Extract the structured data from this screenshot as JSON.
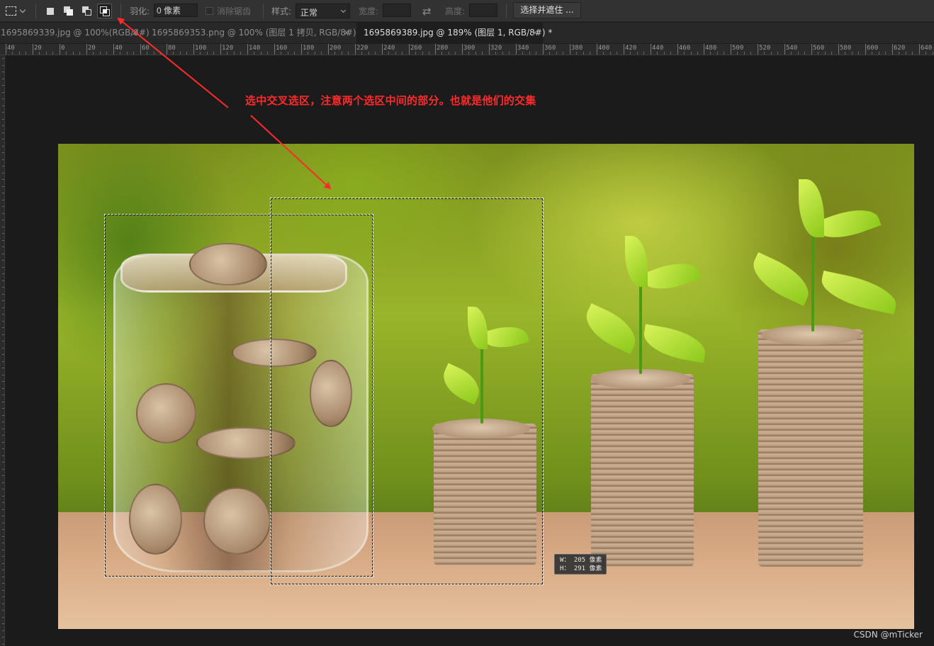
{
  "options_bar": {
    "feather_label": "羽化:",
    "feather_value": "0 像素",
    "antialias_label": "消除锯齿",
    "style_label": "样式:",
    "style_value": "正常",
    "width_label": "宽度:",
    "height_label": "高度:",
    "refine_button": "选择并遮住 ...",
    "selection_modes": [
      "new-selection",
      "add-to-selection",
      "subtract-from-selection",
      "intersect-with-selection"
    ],
    "active_mode": "intersect-with-selection"
  },
  "tabs": [
    {
      "label": "1695869339.jpg @ 100%(RGB/8#)",
      "close": "×",
      "active": false
    },
    {
      "label": "1695869353.png @ 100% (图层 1 拷贝, RGB/8#) *",
      "close": "×",
      "active": false
    },
    {
      "label": "1695869389.jpg @ 189% (图层 1, RGB/8#) *",
      "close": "×",
      "active": true
    }
  ],
  "ruler": {
    "labels": [
      "40",
      "20",
      "0",
      "20",
      "40",
      "60",
      "80",
      "100",
      "120",
      "140",
      "160",
      "180",
      "200",
      "220",
      "240",
      "260",
      "280",
      "300",
      "320",
      "340",
      "360",
      "380",
      "400",
      "420",
      "440",
      "460",
      "480",
      "500",
      "520",
      "540",
      "560",
      "580",
      "600",
      "620",
      "640"
    ]
  },
  "selection_size": {
    "w_line": "W： 205 像素",
    "h_line": "H： 291 像素"
  },
  "annotation": "选中交叉选区，注意两个选区中间的部分。也就是他们的交集",
  "watermark": "CSDN @mTicker",
  "colors": {
    "annotation": "#ff2a2a",
    "canvas_bg": "#1b1b1b",
    "panel_bg": "#323232"
  }
}
